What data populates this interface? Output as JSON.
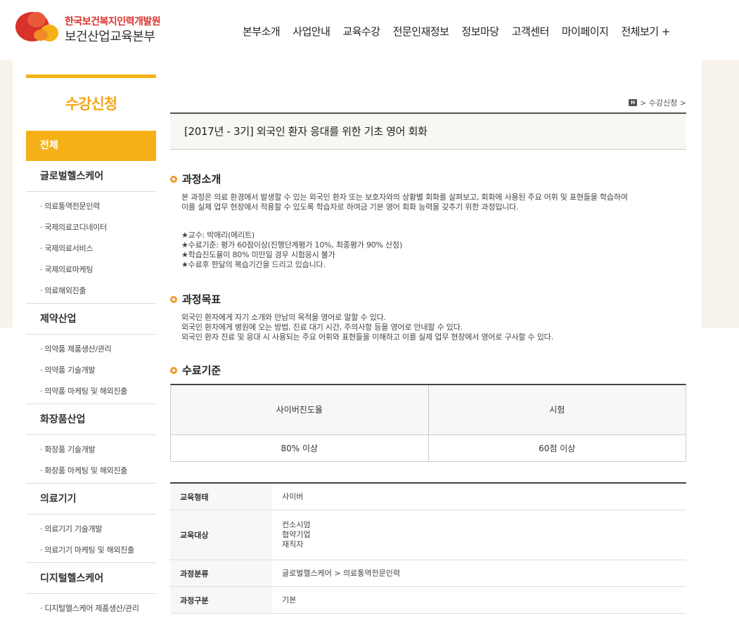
{
  "header": {
    "logo_line1": "한국보건복지인력개발원",
    "logo_line2": "보건산업교육본부",
    "nav": [
      "본부소개",
      "사업안내",
      "교육수강",
      "전문인재정보",
      "정보마당",
      "고객센터",
      "마이페이지",
      "전체보기 +"
    ]
  },
  "sidebar": {
    "title": "수강신청",
    "all_label": "전체",
    "groups": [
      {
        "label": "글로벌헬스케어",
        "items": [
          "· 의료통역전문인력",
          "· 국제의료코디네이터",
          "· 국제의료서비스",
          "· 국제의료마케팅",
          "· 의료해외진출"
        ]
      },
      {
        "label": "제약산업",
        "items": [
          "· 의약품 제품생산/관리",
          "· 의약품 기술개발",
          "· 의약품 마케팅 및 해외진출"
        ]
      },
      {
        "label": "화장품산업",
        "items": [
          "· 화장품 기술개발",
          "· 화장품 마케팅 및 해외진출"
        ]
      },
      {
        "label": "의료기기",
        "items": [
          "· 의료기기 기술개발",
          "· 의료기기 마케팅 및 해외진출"
        ]
      },
      {
        "label": "디지털헬스케어",
        "items": [
          "· 디지털헬스케어 제품생산/관리"
        ]
      }
    ]
  },
  "breadcrumb": {
    "home": "H",
    "current": "수강신청",
    "sep": ">"
  },
  "course": {
    "title": "[2017년 - 3기] 외국인 환자 응대를 위한 기초 영어 회화",
    "intro_head": "과정소개",
    "intro_lines": [
      "본 과정은 의료 환경에서 발생할 수 있는 외국인 환자 또는 보호자와의 상황별 회화를 살펴보고, 회화에 사용된 주요 어휘 및 표현들을 학습하여",
      "이를 실제 업무 현장에서 적용할 수 있도록 학습자로 하여금 기본 영어 회화 능력을 갖추기 위한 과정입니다."
    ],
    "notes": [
      "★교수: 박애리(에리트)",
      "★수료기준: 평가 60점이상(진행단계평가 10%, 최종평가 90% 산정)",
      "★학습진도율이 80% 미만일 경우 시험응시 불가",
      "★수료후 한달의 복습기간을 드리고 있습니다."
    ],
    "goal_head": "과정목표",
    "goal_lines": [
      "외국인 환자에게 자기 소개와 만남의 목적을 영어로 말할 수 있다.",
      "외국인 환자에게 병원에 오는 방법, 진료 대기 시간, 주의사항 등을 영어로 안내할 수 있다.",
      "외국인 환자 진료 및 응대 시 사용되는 주요 어휘와 표현들을 이해하고 이를 실제 업무 현장에서 영어로 구사할 수 있다."
    ],
    "criteria_head": "수료기준",
    "criteria": {
      "headers": [
        "사이버진도율",
        "시험"
      ],
      "values": [
        "80% 이상",
        "60점 이상"
      ]
    },
    "info": [
      {
        "key": "교육형태",
        "values": [
          "사이버"
        ]
      },
      {
        "key": "교육대상",
        "values": [
          "컨소시엄",
          "협약기업",
          "재직자"
        ]
      },
      {
        "key": "과정분류",
        "values": [
          "글로벌헬스케어 > 의료통역전문인력"
        ]
      },
      {
        "key": "과정구분",
        "values": [
          "기본"
        ]
      }
    ]
  },
  "colors": {
    "accent": "#f6b017",
    "bullet": "#f29a2e",
    "logo_red": "#d9322a"
  }
}
